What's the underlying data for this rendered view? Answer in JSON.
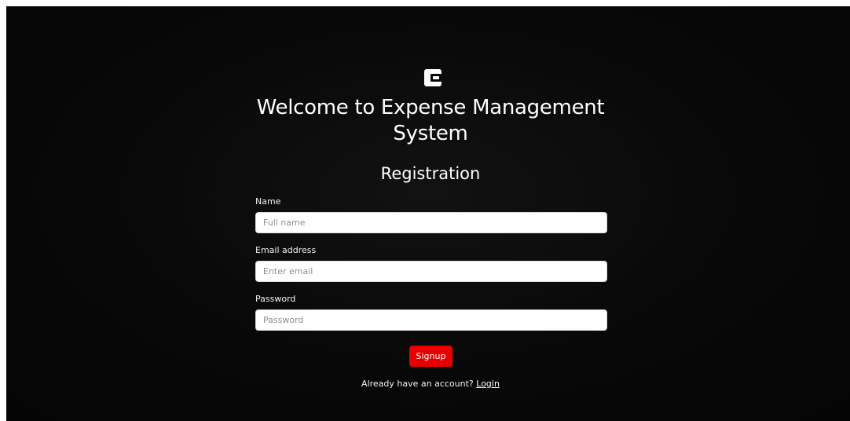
{
  "brand": {
    "logo_icon": "wallet-icon"
  },
  "header": {
    "title": "Welcome to Expense Management System",
    "subtitle": "Registration"
  },
  "form": {
    "name": {
      "label": "Name",
      "placeholder": "Full name",
      "value": ""
    },
    "email": {
      "label": "Email address",
      "placeholder": "Enter email",
      "value": ""
    },
    "password": {
      "label": "Password",
      "placeholder": "Password",
      "value": ""
    },
    "submit_label": "Signup"
  },
  "footer": {
    "prompt": "Already have an account?",
    "login_label": "Login"
  },
  "colors": {
    "background": "#070707",
    "accent": "#e60000",
    "text": "#ffffff"
  }
}
